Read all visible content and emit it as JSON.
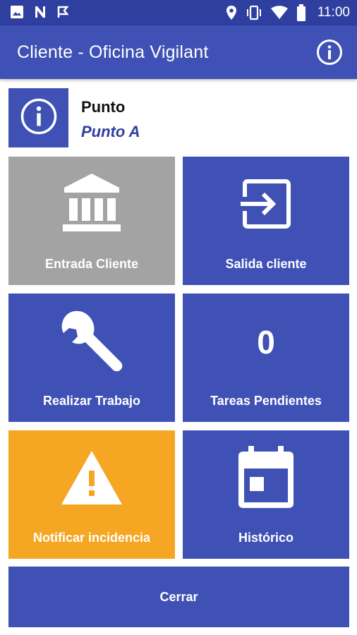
{
  "status_bar": {
    "time": "11:00",
    "left_icons": [
      "image-icon",
      "n-icon",
      "flag-icon"
    ],
    "right_icons": [
      "location-icon",
      "vibrate-icon",
      "wifi-icon",
      "battery-icon"
    ]
  },
  "app_bar": {
    "title": "Cliente - Oficina Vigilant",
    "info_icon": "info-icon"
  },
  "point": {
    "label": "Punto",
    "value": "Punto A",
    "icon": "info-icon"
  },
  "tiles": [
    {
      "label": "Entrada Cliente",
      "icon": "bank-icon",
      "color": "#a3a3a3"
    },
    {
      "label": "Salida cliente",
      "icon": "exit-to-app-icon",
      "color": "#3f51b5"
    },
    {
      "label": "Realizar Trabajo",
      "icon": "wrench-icon",
      "color": "#3f51b5"
    },
    {
      "label": "Tareas Pendientes",
      "count": "0",
      "color": "#3f51b5"
    },
    {
      "label": "Notificar incidencia",
      "icon": "warning-icon",
      "color": "#f5a623"
    },
    {
      "label": "Histórico",
      "icon": "calendar-icon",
      "color": "#3f51b5"
    }
  ],
  "close_button": {
    "label": "Cerrar"
  },
  "colors": {
    "primary": "#3f51b5",
    "primary_dark": "#2f3fa0",
    "disabled": "#a3a3a3",
    "warning": "#f5a623"
  }
}
